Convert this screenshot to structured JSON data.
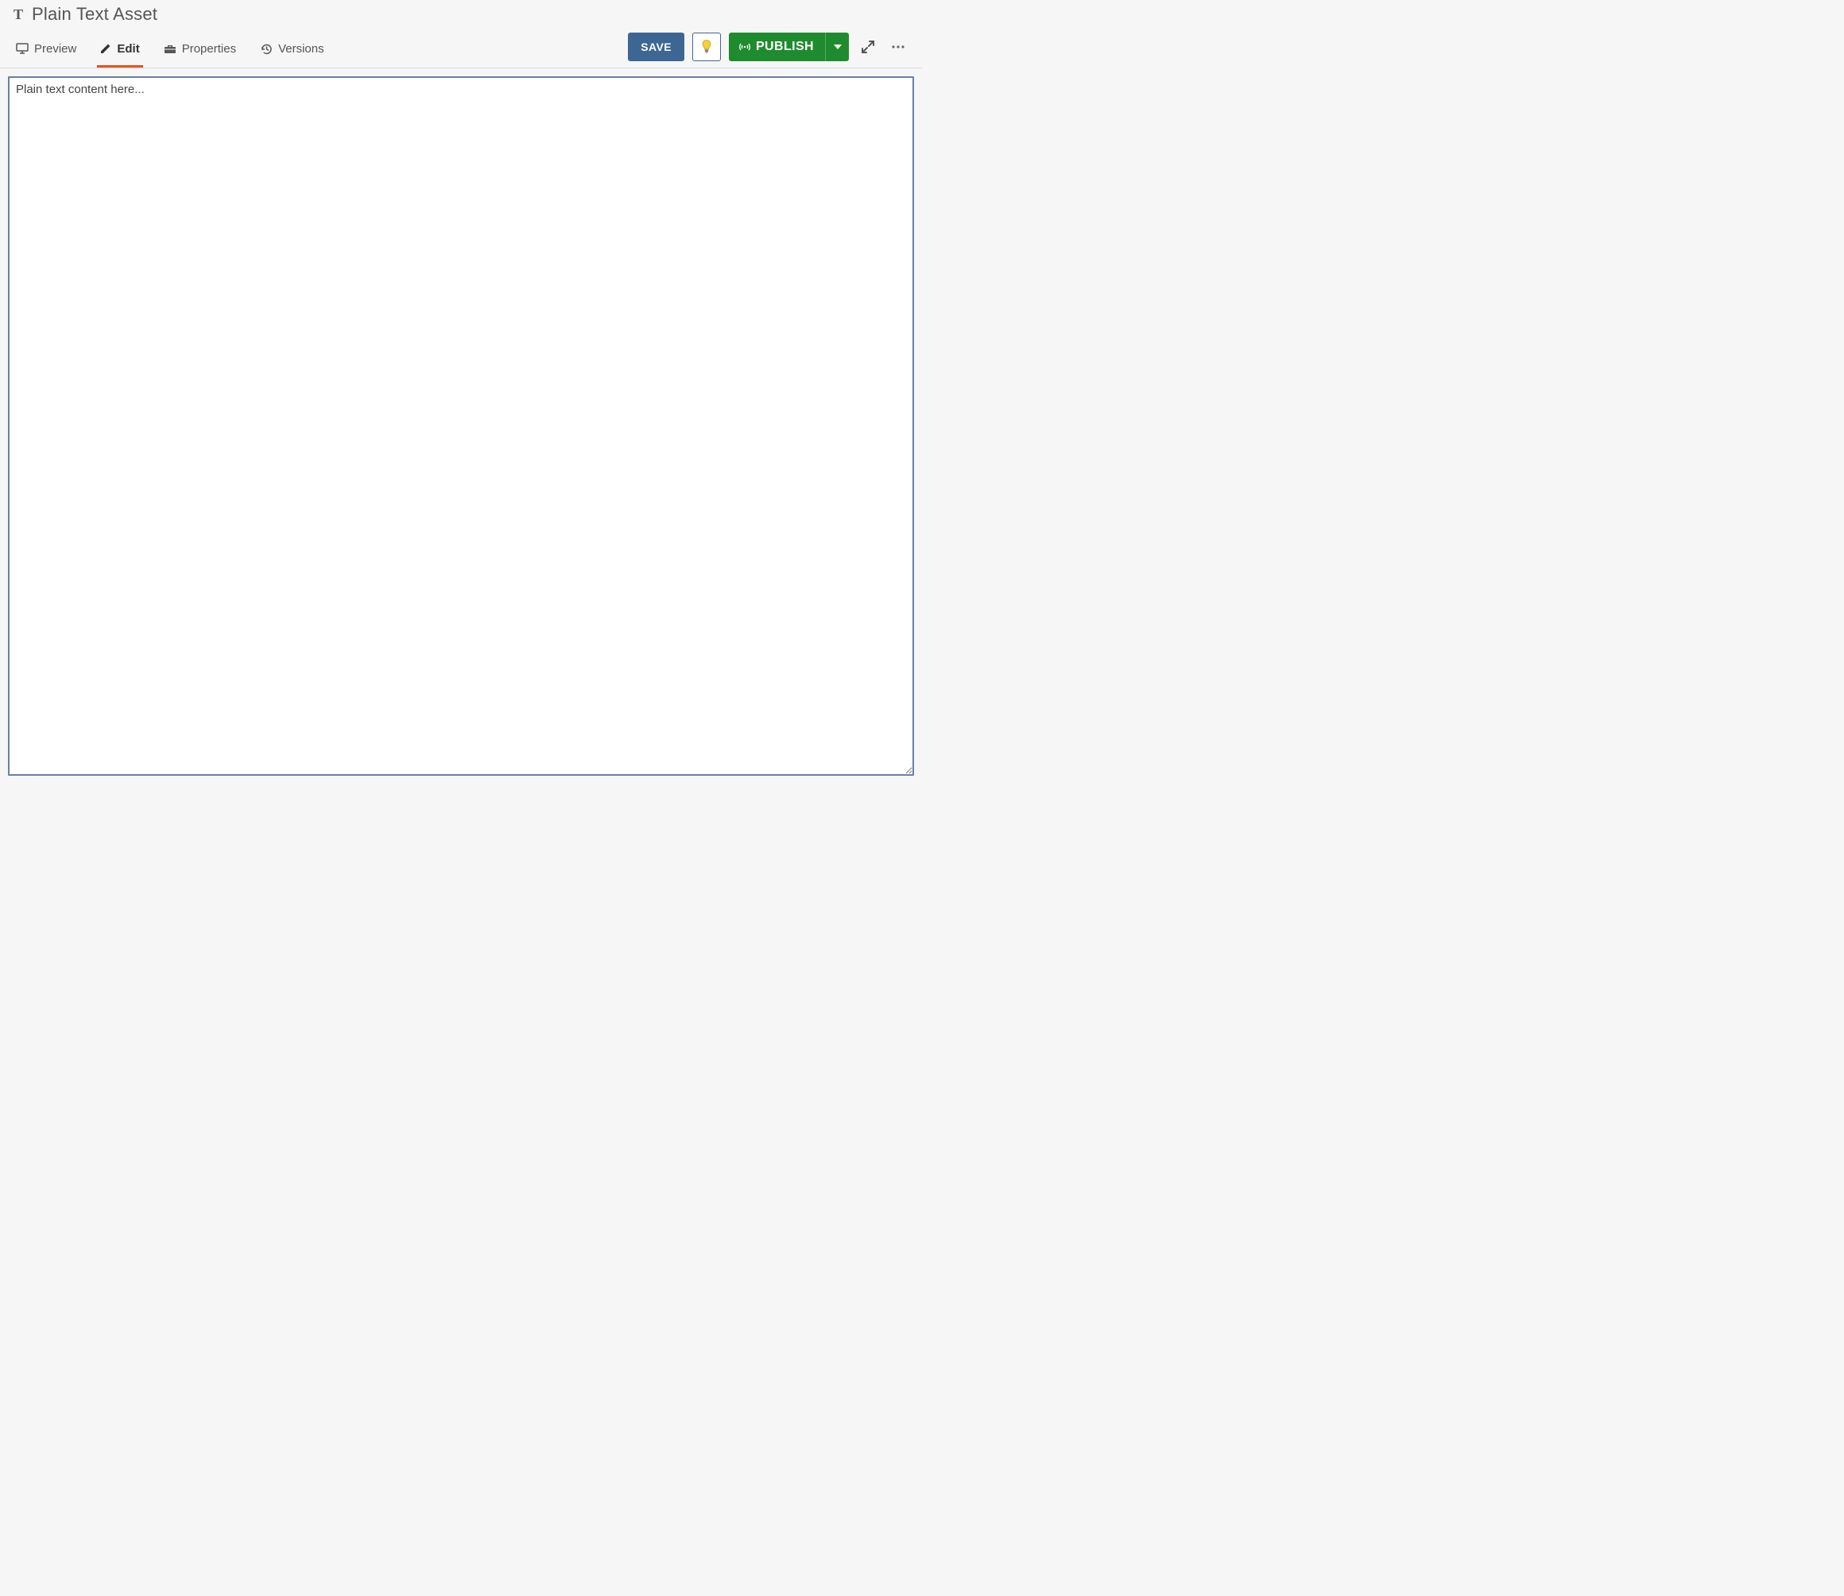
{
  "header": {
    "icon_glyph": "T",
    "title": "Plain Text Asset"
  },
  "tabs": {
    "preview": "Preview",
    "edit": "Edit",
    "properties": "Properties",
    "versions": "Versions",
    "active": "edit"
  },
  "actions": {
    "save_label": "SAVE",
    "publish_label": "PUBLISH"
  },
  "editor": {
    "value": "Plain text content here...",
    "placeholder": ""
  },
  "icons": {
    "preview": "monitor-icon",
    "edit": "pencil-icon",
    "properties": "toolbox-icon",
    "versions": "history-icon",
    "hint": "lightbulb-icon",
    "publish": "broadcast-icon",
    "expand": "expand-icon",
    "more": "dots-icon"
  },
  "colors": {
    "accent_tab": "#f04d1b",
    "save": "#3c6694",
    "publish": "#1f8b2f",
    "border_focus": "#6a80a4",
    "bg": "#f6f6f6"
  }
}
